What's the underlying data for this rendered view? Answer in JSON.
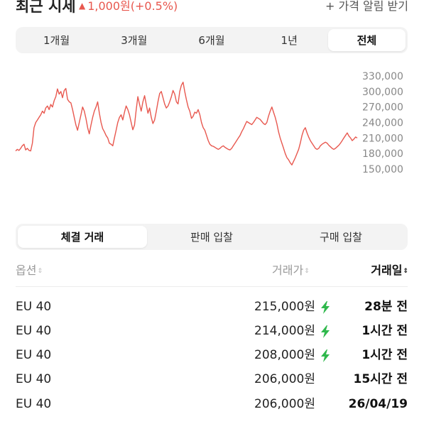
{
  "header": {
    "title": "최근 시세",
    "change": "1,000원(+0.5%)",
    "change_color": "#e8584f",
    "alert_label": "+ 가격 알림 받기"
  },
  "periods": [
    {
      "label": "1개월",
      "active": false
    },
    {
      "label": "3개월",
      "active": false
    },
    {
      "label": "6개월",
      "active": false
    },
    {
      "label": "1년",
      "active": false
    },
    {
      "label": "전체",
      "active": true
    }
  ],
  "chart_data": {
    "type": "line",
    "title": "",
    "xlabel": "",
    "ylabel": "",
    "ylim": [
      150000,
      330000
    ],
    "y_ticks": [
      "330,000",
      "300,000",
      "270,000",
      "240,000",
      "210,000",
      "180,000",
      "150,000"
    ],
    "y_tick_values": [
      330000,
      300000,
      270000,
      240000,
      210000,
      180000,
      150000
    ],
    "line_color": "#e8584f",
    "grid": false,
    "series": [
      {
        "values": [
          185000,
          188000,
          186000,
          190000,
          195000,
          198000,
          187000,
          190000,
          186000,
          185000,
          200000,
          230000,
          240000,
          245000,
          250000,
          255000,
          262000,
          258000,
          268000,
          272000,
          265000,
          275000,
          270000,
          282000,
          290000,
          305000,
          295000,
          300000,
          288000,
          302000,
          306000,
          285000,
          280000,
          278000,
          265000,
          250000,
          235000,
          225000,
          240000,
          255000,
          270000,
          262000,
          248000,
          230000,
          218000,
          235000,
          250000,
          262000,
          270000,
          280000,
          258000,
          240000,
          228000,
          222000,
          215000,
          210000,
          200000,
          198000,
          195000,
          210000,
          225000,
          240000,
          250000,
          255000,
          245000,
          260000,
          272000,
          265000,
          255000,
          240000,
          226000,
          235000,
          265000,
          290000,
          275000,
          262000,
          280000,
          292000,
          275000,
          258000,
          268000,
          250000,
          238000,
          245000,
          262000,
          280000,
          296000,
          300000,
          288000,
          276000,
          268000,
          272000,
          280000,
          290000,
          302000,
          295000,
          280000,
          276000,
          300000,
          312000,
          318000,
          300000,
          284000,
          270000,
          262000,
          248000,
          252000,
          260000,
          258000,
          265000,
          255000,
          240000,
          230000,
          225000,
          215000,
          205000,
          198000,
          195000,
          194000,
          192000,
          190000,
          188000,
          190000,
          193000,
          195000,
          192000,
          190000,
          188000,
          187000,
          190000,
          195000,
          200000,
          205000,
          210000,
          215000,
          222000,
          228000,
          235000,
          242000,
          240000,
          238000,
          236000,
          240000,
          245000,
          250000,
          248000,
          246000,
          242000,
          238000,
          236000,
          240000,
          252000,
          262000,
          270000,
          260000,
          250000,
          238000,
          222000,
          210000,
          200000,
          190000,
          180000,
          172000,
          168000,
          162000,
          158000,
          165000,
          172000,
          180000,
          188000,
          200000,
          215000,
          225000,
          230000,
          220000,
          212000,
          205000,
          200000,
          195000,
          190000,
          188000,
          190000,
          195000,
          198000,
          200000,
          202000,
          200000,
          196000,
          193000,
          190000,
          188000,
          190000,
          193000,
          196000,
          200000,
          205000,
          210000,
          215000,
          220000,
          214000,
          210000,
          205000,
          208000,
          212000,
          210000
        ]
      }
    ]
  },
  "trade_tabs": [
    {
      "label": "체결 거래",
      "active": true
    },
    {
      "label": "판매 입찰",
      "active": false
    },
    {
      "label": "구매 입찰",
      "active": false
    }
  ],
  "table": {
    "columns": [
      {
        "label": "옵션",
        "sort": "⇕",
        "active": false
      },
      {
        "label": "거래가",
        "sort": "⇕",
        "active": false
      },
      {
        "label": "거래일",
        "sort": "⇕",
        "active": true
      }
    ],
    "rows": [
      {
        "option": "EU 40",
        "price": "215,000원",
        "fast": true,
        "date": "28분 전"
      },
      {
        "option": "EU 40",
        "price": "214,000원",
        "fast": true,
        "date": "1시간 전"
      },
      {
        "option": "EU 40",
        "price": "208,000원",
        "fast": true,
        "date": "1시간 전"
      },
      {
        "option": "EU 40",
        "price": "206,000원",
        "fast": false,
        "date": "15시간 전"
      },
      {
        "option": "EU 40",
        "price": "206,000원",
        "fast": false,
        "date": "26/04/19"
      }
    ]
  },
  "icons": {
    "fast_delivery": "lightning-bolt-icon",
    "bolt_color": "#2fb84c"
  }
}
